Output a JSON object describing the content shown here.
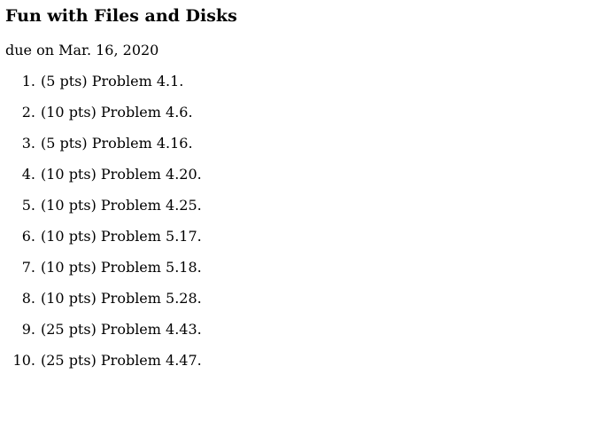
{
  "title": "Fun with Files and Disks",
  "due": "due on Mar. 16, 2020",
  "problems": [
    {
      "num": "1.",
      "text": "(5 pts) Problem 4.1."
    },
    {
      "num": "2.",
      "text": "(10 pts) Problem 4.6."
    },
    {
      "num": "3.",
      "text": "(5 pts) Problem 4.16."
    },
    {
      "num": "4.",
      "text": "(10 pts) Problem 4.20."
    },
    {
      "num": "5.",
      "text": "(10 pts) Problem 4.25."
    },
    {
      "num": "6.",
      "text": "(10 pts) Problem 5.17."
    },
    {
      "num": "7.",
      "text": "(10 pts) Problem 5.18."
    },
    {
      "num": "8.",
      "text": "(10 pts) Problem 5.28."
    },
    {
      "num": "9.",
      "text": "(25 pts) Problem 4.43."
    },
    {
      "num": "10.",
      "text": "(25 pts) Problem 4.47."
    }
  ]
}
